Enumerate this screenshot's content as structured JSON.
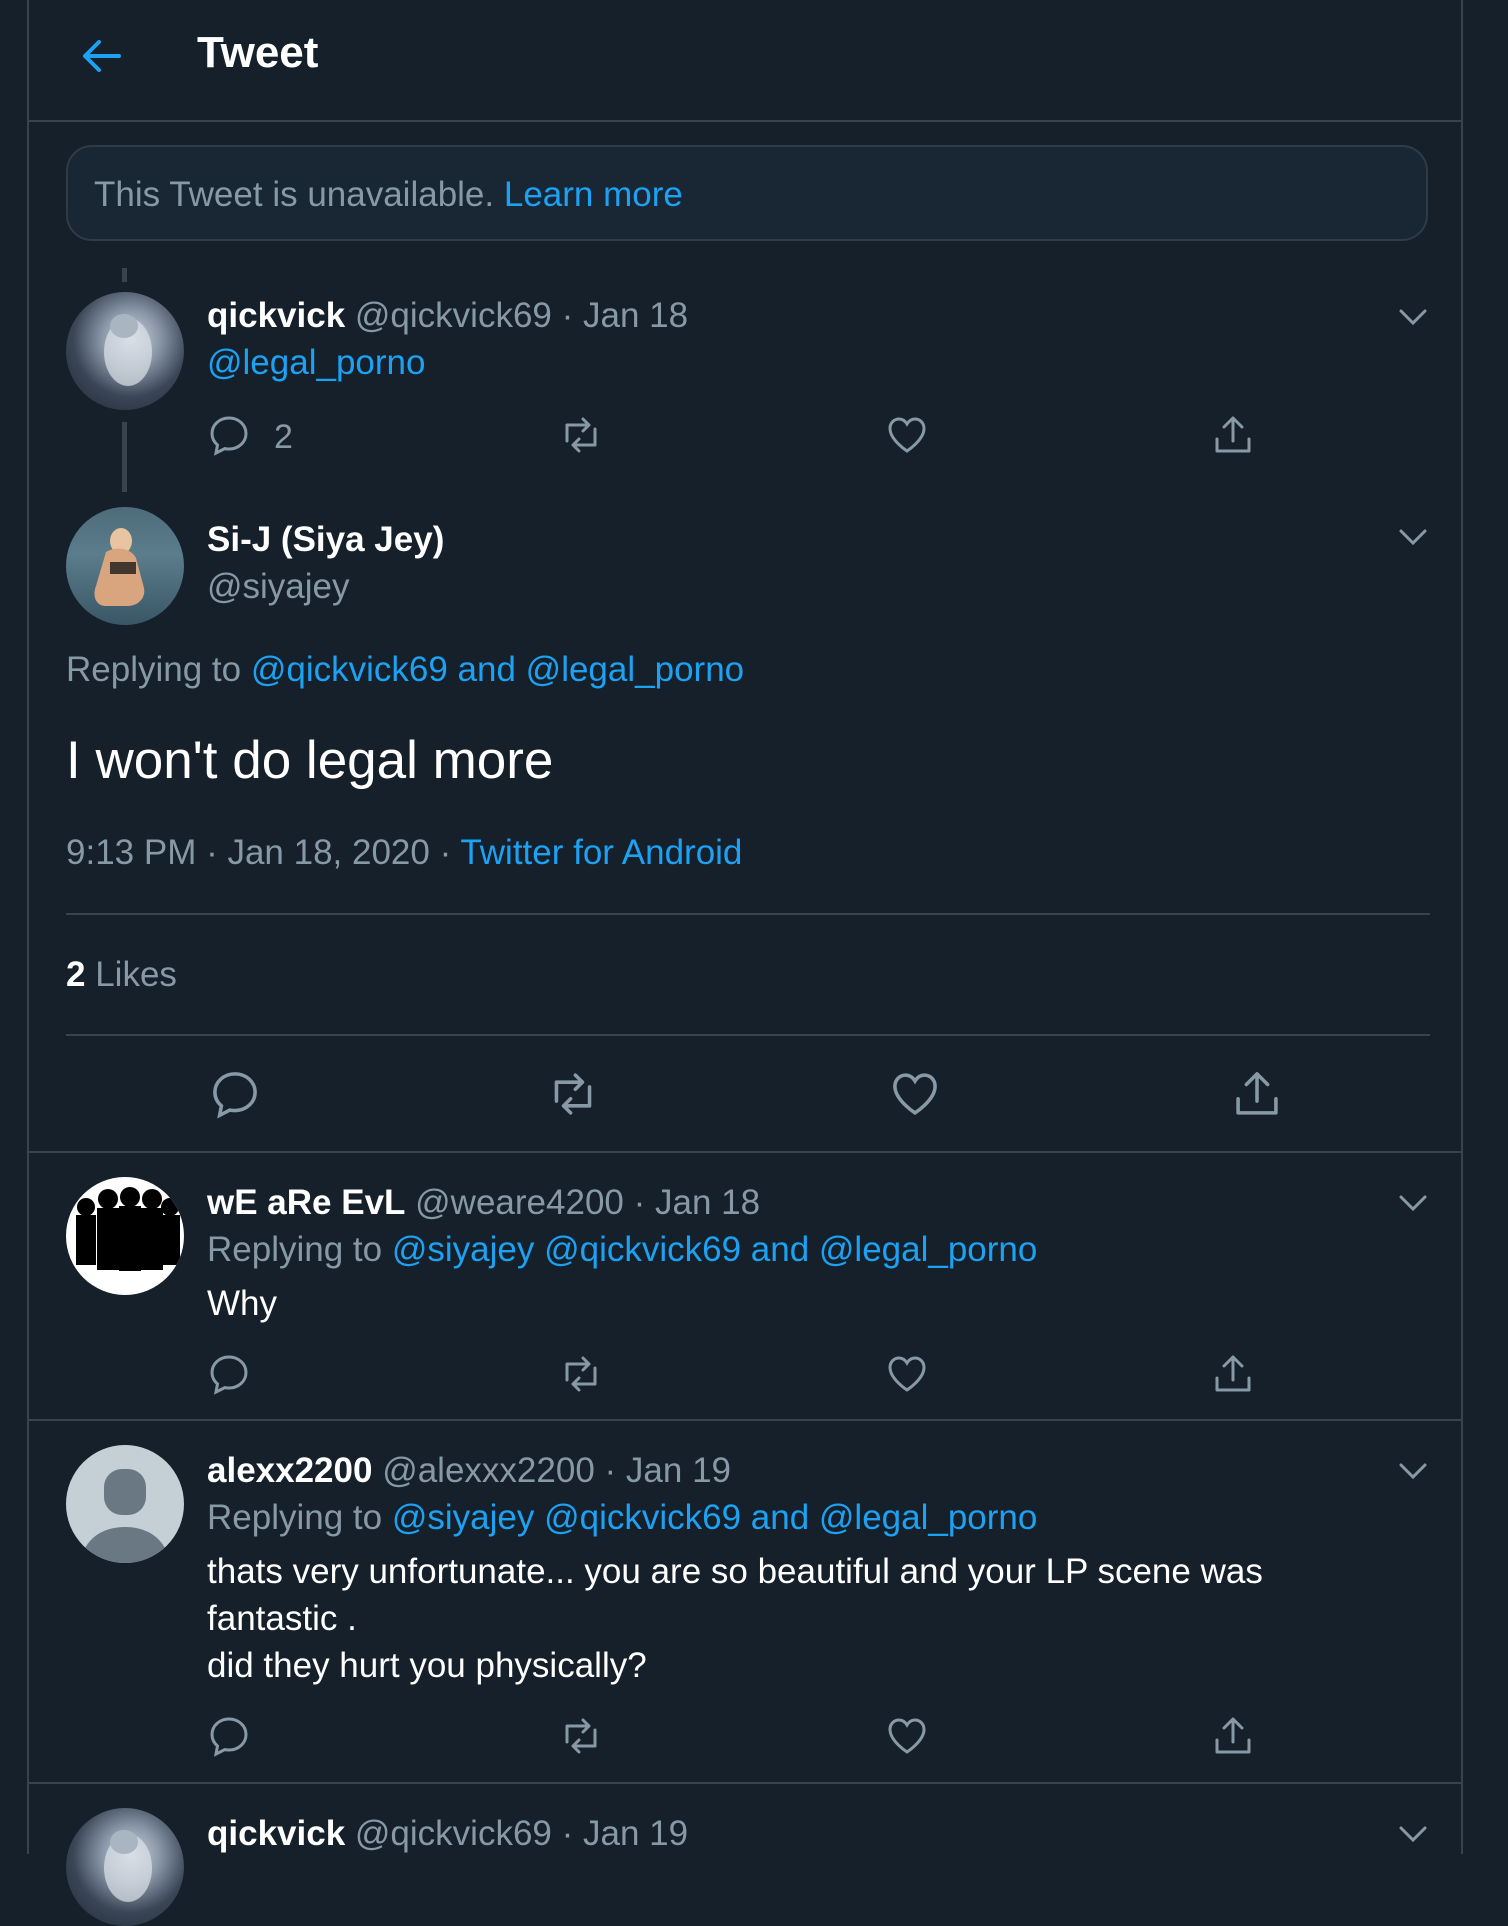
{
  "header": {
    "title": "Tweet"
  },
  "notice": {
    "text": "This Tweet is unavailable.",
    "link": "Learn more"
  },
  "tweet1": {
    "name": "qickvick",
    "handle": "@qickvick69",
    "sep": "·",
    "date": "Jan 18",
    "text": "@legal_porno",
    "reply_count": "2"
  },
  "main": {
    "name": "Si-J (Siya Jey)",
    "handle": "@siyajey",
    "replying_prefix": "Replying to",
    "replying_users": "@qickvick69 and @legal_porno",
    "text": "I won't do legal more",
    "time": "9:13 PM · Jan 18, 2020 ·",
    "source": "Twitter for Android",
    "likes_count": "2",
    "likes_label": "Likes"
  },
  "reply1": {
    "name": "wE aRe EvL",
    "handle": "@weare4200",
    "sep": "·",
    "date": "Jan 18",
    "replying_prefix": "Replying to",
    "replying_users": "@siyajey @qickvick69 and @legal_porno",
    "text": "Why"
  },
  "reply2": {
    "name": "alexx2200",
    "handle": "@alexxx2200",
    "sep": "·",
    "date": "Jan 19",
    "replying_prefix": "Replying to",
    "replying_users": "@siyajey @qickvick69 and @legal_porno",
    "text_line1": "thats very unfortunate... you are so beautiful and your LP scene was",
    "text_line2": "fantastic .",
    "text_line3": "did they hurt you physically?"
  },
  "reply3": {
    "name": "qickvick",
    "handle": "@qickvick69",
    "sep": "·",
    "date": "Jan 19"
  },
  "colors": {
    "background": "#15202b",
    "accent": "#1da1f2",
    "muted": "#8899a6",
    "border": "#38444d"
  },
  "icons": [
    "back-arrow-icon",
    "chevron-down-icon",
    "reply-icon",
    "retweet-icon",
    "like-icon",
    "share-icon"
  ]
}
